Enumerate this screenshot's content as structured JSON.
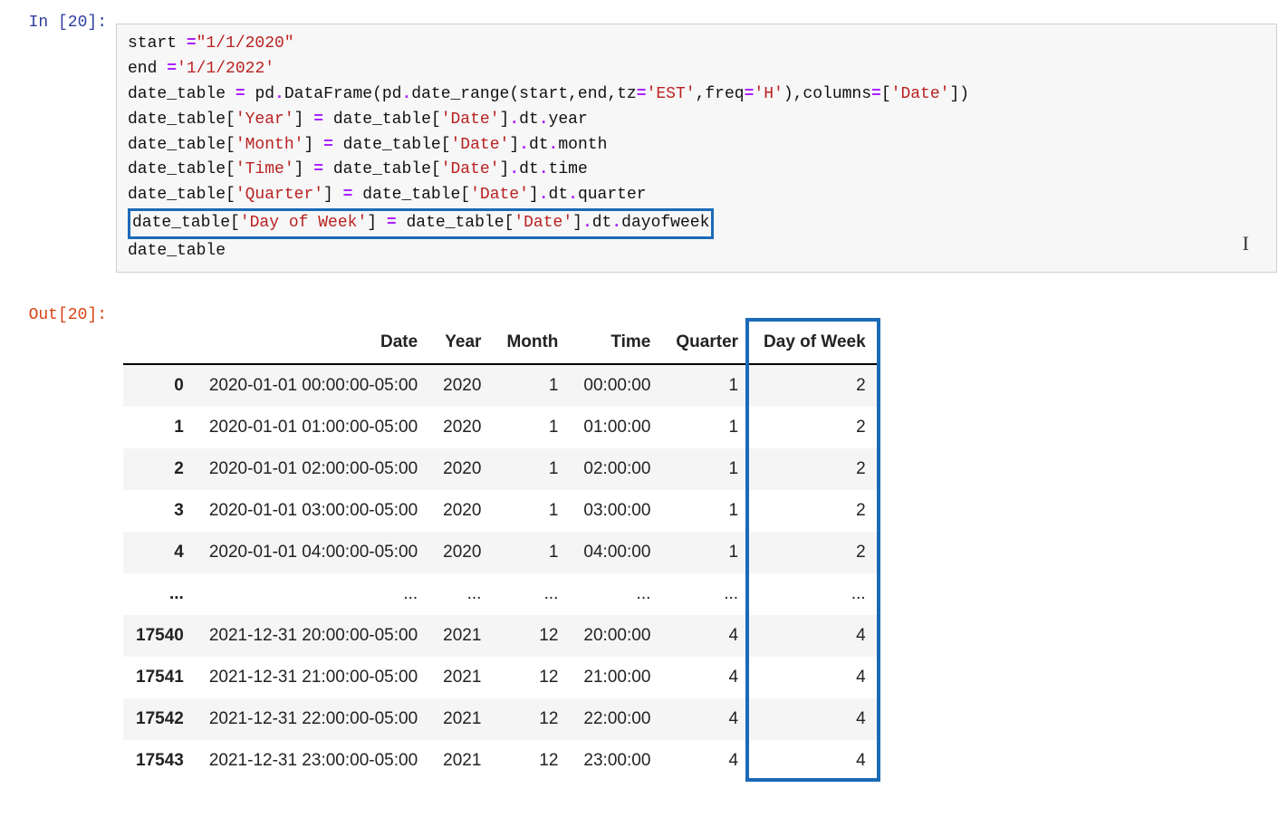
{
  "input": {
    "prompt": "In [20]:",
    "code_tokens": [
      [
        {
          "t": "start ",
          "c": ""
        },
        {
          "t": "=",
          "c": "c-op"
        },
        {
          "t": "\"1/1/2020\"",
          "c": "c-str"
        }
      ],
      [
        {
          "t": "end ",
          "c": ""
        },
        {
          "t": "=",
          "c": "c-op"
        },
        {
          "t": "'1/1/2022'",
          "c": "c-str"
        }
      ],
      [
        {
          "t": "date_table ",
          "c": ""
        },
        {
          "t": "=",
          "c": "c-op"
        },
        {
          "t": " pd",
          "c": ""
        },
        {
          "t": ".",
          "c": "c-op"
        },
        {
          "t": "DataFrame(pd",
          "c": ""
        },
        {
          "t": ".",
          "c": "c-op"
        },
        {
          "t": "date_range(start,end,tz",
          "c": ""
        },
        {
          "t": "=",
          "c": "c-op"
        },
        {
          "t": "'EST'",
          "c": "c-str"
        },
        {
          "t": ",freq",
          "c": ""
        },
        {
          "t": "=",
          "c": "c-op"
        },
        {
          "t": "'H'",
          "c": "c-str"
        },
        {
          "t": "),columns",
          "c": ""
        },
        {
          "t": "=",
          "c": "c-op"
        },
        {
          "t": "[",
          "c": ""
        },
        {
          "t": "'Date'",
          "c": "c-str"
        },
        {
          "t": "])",
          "c": ""
        }
      ],
      [
        {
          "t": "date_table[",
          "c": ""
        },
        {
          "t": "'Year'",
          "c": "c-str"
        },
        {
          "t": "] ",
          "c": ""
        },
        {
          "t": "=",
          "c": "c-op"
        },
        {
          "t": " date_table[",
          "c": ""
        },
        {
          "t": "'Date'",
          "c": "c-str"
        },
        {
          "t": "]",
          "c": ""
        },
        {
          "t": ".",
          "c": "c-op"
        },
        {
          "t": "dt",
          "c": ""
        },
        {
          "t": ".",
          "c": "c-op"
        },
        {
          "t": "year",
          "c": ""
        }
      ],
      [
        {
          "t": "date_table[",
          "c": ""
        },
        {
          "t": "'Month'",
          "c": "c-str"
        },
        {
          "t": "] ",
          "c": ""
        },
        {
          "t": "=",
          "c": "c-op"
        },
        {
          "t": " date_table[",
          "c": ""
        },
        {
          "t": "'Date'",
          "c": "c-str"
        },
        {
          "t": "]",
          "c": ""
        },
        {
          "t": ".",
          "c": "c-op"
        },
        {
          "t": "dt",
          "c": ""
        },
        {
          "t": ".",
          "c": "c-op"
        },
        {
          "t": "month",
          "c": ""
        }
      ],
      [
        {
          "t": "date_table[",
          "c": ""
        },
        {
          "t": "'Time'",
          "c": "c-str"
        },
        {
          "t": "] ",
          "c": ""
        },
        {
          "t": "=",
          "c": "c-op"
        },
        {
          "t": " date_table[",
          "c": ""
        },
        {
          "t": "'Date'",
          "c": "c-str"
        },
        {
          "t": "]",
          "c": ""
        },
        {
          "t": ".",
          "c": "c-op"
        },
        {
          "t": "dt",
          "c": ""
        },
        {
          "t": ".",
          "c": "c-op"
        },
        {
          "t": "time",
          "c": ""
        }
      ],
      [
        {
          "t": "date_table[",
          "c": ""
        },
        {
          "t": "'Quarter'",
          "c": "c-str"
        },
        {
          "t": "] ",
          "c": ""
        },
        {
          "t": "=",
          "c": "c-op"
        },
        {
          "t": " date_table[",
          "c": ""
        },
        {
          "t": "'Date'",
          "c": "c-str"
        },
        {
          "t": "]",
          "c": ""
        },
        {
          "t": ".",
          "c": "c-op"
        },
        {
          "t": "dt",
          "c": ""
        },
        {
          "t": ".",
          "c": "c-op"
        },
        {
          "t": "quarter",
          "c": ""
        }
      ],
      [
        {
          "t": "date_table[",
          "c": "",
          "hl_start": true
        },
        {
          "t": "'Day of Week'",
          "c": "c-str"
        },
        {
          "t": "] ",
          "c": ""
        },
        {
          "t": "=",
          "c": "c-op"
        },
        {
          "t": " date_table[",
          "c": ""
        },
        {
          "t": "'Date'",
          "c": "c-str"
        },
        {
          "t": "]",
          "c": ""
        },
        {
          "t": ".",
          "c": "c-op"
        },
        {
          "t": "dt",
          "c": ""
        },
        {
          "t": ".",
          "c": "c-op"
        },
        {
          "t": "dayofweek",
          "c": "",
          "hl_end": true
        }
      ],
      [
        {
          "t": "date_table",
          "c": ""
        }
      ]
    ]
  },
  "output": {
    "prompt": "Out[20]:",
    "columns": [
      "",
      "Date",
      "Year",
      "Month",
      "Time",
      "Quarter",
      "Day of Week"
    ],
    "rows": [
      {
        "idx": "0",
        "cells": [
          "2020-01-01 00:00:00-05:00",
          "2020",
          "1",
          "00:00:00",
          "1",
          "2"
        ]
      },
      {
        "idx": "1",
        "cells": [
          "2020-01-01 01:00:00-05:00",
          "2020",
          "1",
          "01:00:00",
          "1",
          "2"
        ]
      },
      {
        "idx": "2",
        "cells": [
          "2020-01-01 02:00:00-05:00",
          "2020",
          "1",
          "02:00:00",
          "1",
          "2"
        ]
      },
      {
        "idx": "3",
        "cells": [
          "2020-01-01 03:00:00-05:00",
          "2020",
          "1",
          "03:00:00",
          "1",
          "2"
        ]
      },
      {
        "idx": "4",
        "cells": [
          "2020-01-01 04:00:00-05:00",
          "2020",
          "1",
          "04:00:00",
          "1",
          "2"
        ]
      },
      {
        "idx": "...",
        "cells": [
          "...",
          "...",
          "...",
          "...",
          "...",
          "..."
        ]
      },
      {
        "idx": "17540",
        "cells": [
          "2021-12-31 20:00:00-05:00",
          "2021",
          "12",
          "20:00:00",
          "4",
          "4"
        ]
      },
      {
        "idx": "17541",
        "cells": [
          "2021-12-31 21:00:00-05:00",
          "2021",
          "12",
          "21:00:00",
          "4",
          "4"
        ]
      },
      {
        "idx": "17542",
        "cells": [
          "2021-12-31 22:00:00-05:00",
          "2021",
          "12",
          "22:00:00",
          "4",
          "4"
        ]
      },
      {
        "idx": "17543",
        "cells": [
          "2021-12-31 23:00:00-05:00",
          "2021",
          "12",
          "23:00:00",
          "4",
          "4"
        ]
      }
    ],
    "highlight_column_index": 6
  },
  "cursor_glyph": "I"
}
